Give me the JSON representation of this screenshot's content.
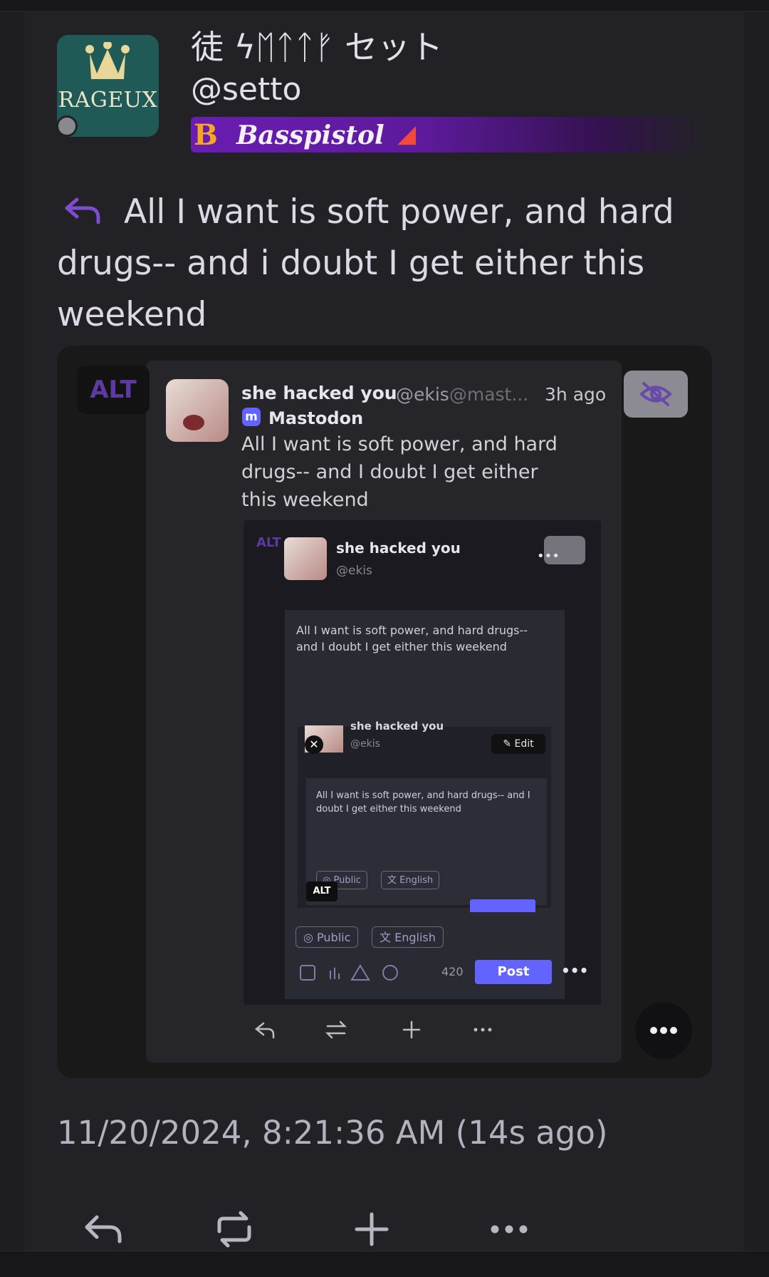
{
  "status": {
    "display_name": "徒 ϟᛖᛏᛏᚠ セット",
    "handle": "@setto",
    "avatar_brand_text": "RAGEUX",
    "badge": {
      "initial": "B",
      "label": "Basspistol"
    },
    "post_text": "All I want is soft power, and hard drugs-- and i doubt I get either this weekend",
    "timestamp": "11/20/2024, 8:21:36 AM (14s ago)"
  },
  "media": {
    "alt_label": "ALT",
    "screenshot": {
      "name": "she hacked you",
      "handle": "@ekis",
      "handle_domain": "@mast...",
      "time": "3h ago",
      "app": "Mastodon",
      "text": "All I want is soft power, and hard drugs-- and I doubt I get either this weekend",
      "nested": {
        "alt_label": "ALT",
        "name": "she hacked you",
        "handle": "@ekis",
        "text": "All I want is soft power, and hard drugs-- and I doubt I get either this weekend",
        "visibility": "Public",
        "language": "English",
        "char_count": "420",
        "post_label": "Post",
        "inner": {
          "name": "she hacked you",
          "handle": "@ekis",
          "edit_label": "Edit",
          "text": "All I want is soft power, and hard drugs-- and I doubt I get either this weekend",
          "visibility": "Public",
          "language": "English",
          "alt_label": "ALT"
        }
      }
    }
  },
  "icons": [
    "reply-icon",
    "boost-icon",
    "add-icon",
    "more-icon",
    "eye-off-icon"
  ],
  "colors": {
    "accent": "#6c3fb5",
    "mastodon": "#6364ff",
    "badge": "#6a1db0"
  }
}
